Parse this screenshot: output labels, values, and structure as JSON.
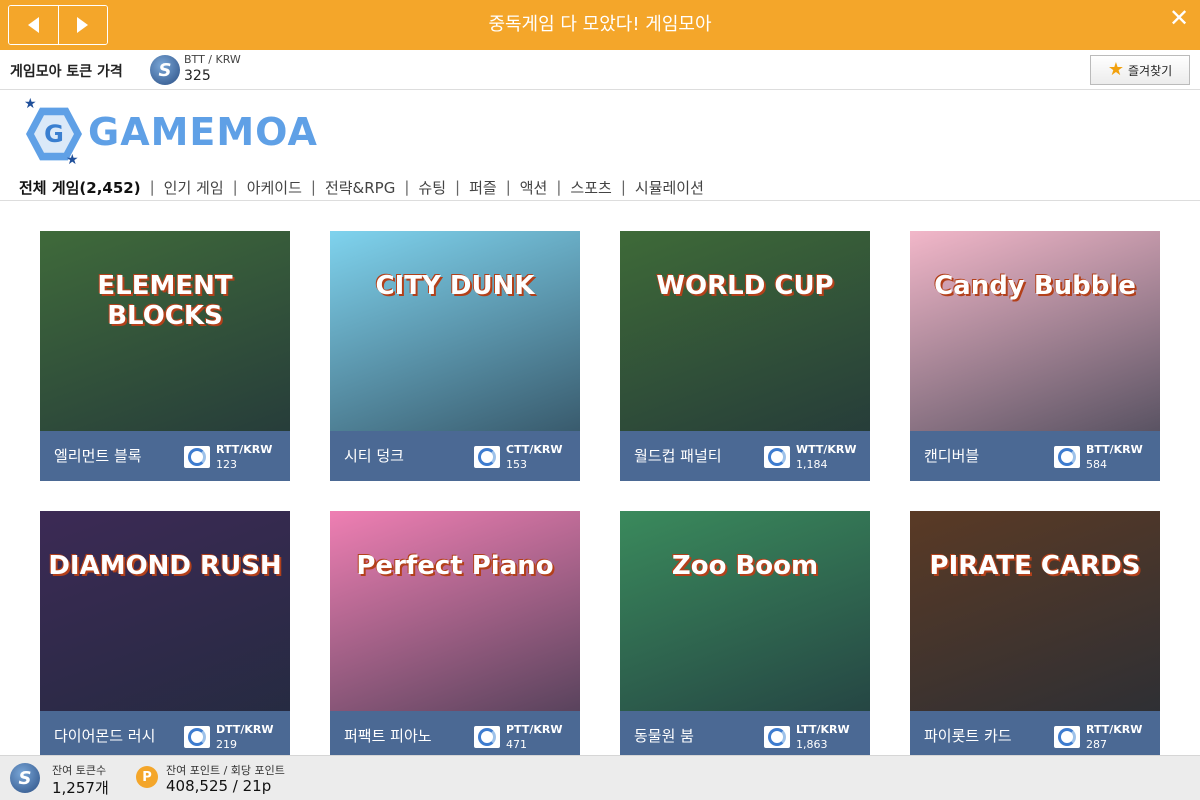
{
  "window": {
    "title": "중독게임 다 모았다! 게임모아",
    "back_icon": "left-arrow-icon",
    "forward_icon": "right-arrow-icon",
    "close_symbol": "✕"
  },
  "price_bar": {
    "label": "게임모아 토큰 가격",
    "pair": "BTT / KRW",
    "value": "325",
    "favorite_label": "즐겨찾기",
    "favorite_icon": "★"
  },
  "logo": {
    "text": "GAMEMOA",
    "badge_letter": "G"
  },
  "categories": [
    {
      "label": "전체 게임(2,452)",
      "active": true
    },
    {
      "label": "인기 게임"
    },
    {
      "label": "아케이드"
    },
    {
      "label": "전략&RPG"
    },
    {
      "label": "슈팅"
    },
    {
      "label": "퍼즐"
    },
    {
      "label": "액션"
    },
    {
      "label": "스포츠"
    },
    {
      "label": "시뮬레이션"
    }
  ],
  "games": [
    {
      "name": "엘리먼트 블록",
      "pair": "RTT/KRW",
      "value": "123",
      "art_title": "ELEMENT BLOCKS",
      "bg": "#3f6a3a"
    },
    {
      "name": "시티 덩크",
      "pair": "CTT/KRW",
      "value": "153",
      "art_title": "CITY DUNK",
      "bg": "#7fd3ee"
    },
    {
      "name": "월드컵 패널티",
      "pair": "WTT/KRW",
      "value": "1,184",
      "art_title": "WORLD CUP",
      "bg": "#3e6a38"
    },
    {
      "name": "캔디버블",
      "pair": "BTT/KRW",
      "value": "584",
      "art_title": "Candy Bubble",
      "bg": "#f2b7c9"
    },
    {
      "name": "다이어몬드 러시",
      "pair": "DTT/KRW",
      "value": "219",
      "art_title": "DIAMOND RUSH",
      "bg": "#3c2a55"
    },
    {
      "name": "퍼팩트 피아노",
      "pair": "PTT/KRW",
      "value": "471",
      "art_title": "Perfect Piano",
      "bg": "#ef7fb3"
    },
    {
      "name": "동물원 붐",
      "pair": "LTT/KRW",
      "value": "1,863",
      "art_title": "Zoo Boom",
      "bg": "#3a8a5c"
    },
    {
      "name": "파이롯트 카드",
      "pair": "RTT/KRW",
      "value": "287",
      "art_title": "PIRATE CARDS",
      "bg": "#5a3a25"
    }
  ],
  "bottom_bar": {
    "balance_label": "잔여 토큰수",
    "balance_value": "1,257개",
    "point_icon": "P",
    "points_label": "잔여 포인트 / 회당 포인트",
    "points_value": "408,525 / 21p"
  }
}
